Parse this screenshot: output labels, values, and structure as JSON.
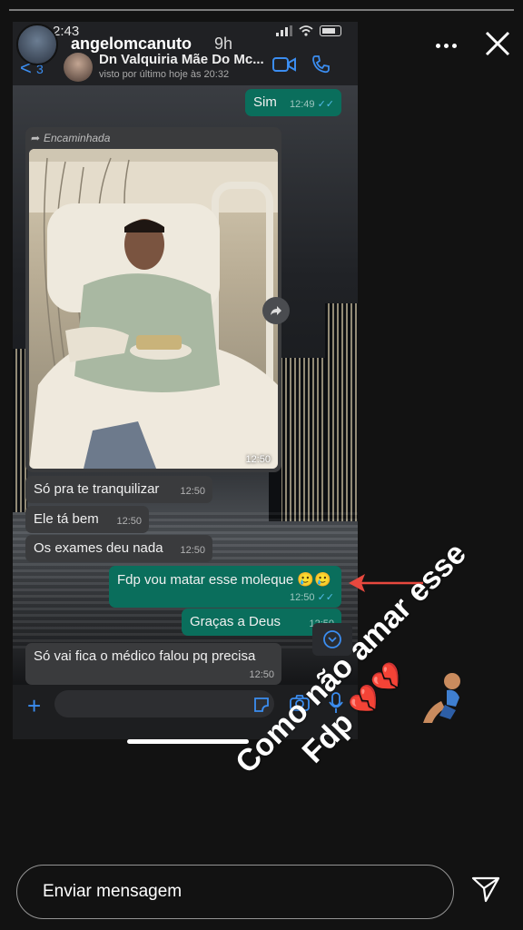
{
  "story": {
    "username": "angelomcanuto",
    "time_ago": "9h",
    "caption_line1": "Como não amar esse",
    "caption_line2": "Fdp",
    "caption_hearts": "💔💔",
    "reply_placeholder": "Enviar mensagem"
  },
  "screenshot": {
    "status_time": "2:43",
    "back_count": "3",
    "back_glyph": "<",
    "contact_name": "Dn Valquiria Mãe Do Mc...",
    "contact_status": "visto por último hoje às 20:32",
    "forwarded_label": "Encaminhada",
    "photo_time": "12:50",
    "messages": [
      {
        "text": "Sim",
        "time": "12:49",
        "ticks": "✓✓"
      },
      {
        "text": "Só pra te tranquilizar",
        "time": "12:50"
      },
      {
        "text": "Ele tá bem",
        "time": "12:50"
      },
      {
        "text": "Os exames deu nada",
        "time": "12:50"
      },
      {
        "text": "Fdp vou matar esse moleque 🥲🥲",
        "time": "12:50",
        "ticks": "✓✓"
      },
      {
        "text": "Graças a Deus",
        "time": "12:50"
      },
      {
        "text": "Só vai fica o médico falou pq precisa",
        "time": "12:50"
      }
    ],
    "plus_glyph": "+"
  },
  "colors": {
    "outgoing_bubble": "#0a6e5c",
    "incoming_bubble": "#3a3b3d",
    "accent_blue": "#3b8df0",
    "arrow_red": "#e8483e"
  },
  "icons": [
    "more-icon",
    "close-icon",
    "video-call-icon",
    "phone-icon",
    "share-icon",
    "chevron-down-icon",
    "sticker-icon",
    "camera-icon",
    "mic-icon",
    "send-icon",
    "back-icon"
  ]
}
